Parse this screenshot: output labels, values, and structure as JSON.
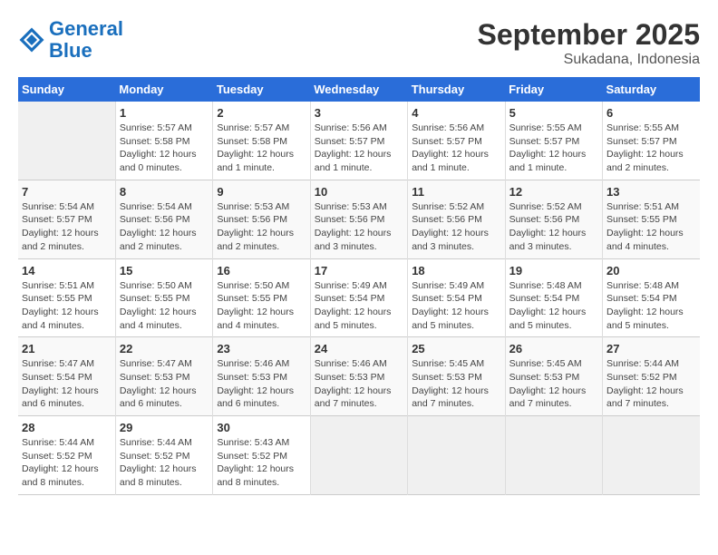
{
  "header": {
    "logo_line1": "General",
    "logo_line2": "Blue",
    "title": "September 2025",
    "subtitle": "Sukadana, Indonesia"
  },
  "calendar": {
    "days_of_week": [
      "Sunday",
      "Monday",
      "Tuesday",
      "Wednesday",
      "Thursday",
      "Friday",
      "Saturday"
    ],
    "weeks": [
      [
        {
          "day": "",
          "info": ""
        },
        {
          "day": "1",
          "info": "Sunrise: 5:57 AM\nSunset: 5:58 PM\nDaylight: 12 hours\nand 0 minutes."
        },
        {
          "day": "2",
          "info": "Sunrise: 5:57 AM\nSunset: 5:58 PM\nDaylight: 12 hours\nand 1 minute."
        },
        {
          "day": "3",
          "info": "Sunrise: 5:56 AM\nSunset: 5:57 PM\nDaylight: 12 hours\nand 1 minute."
        },
        {
          "day": "4",
          "info": "Sunrise: 5:56 AM\nSunset: 5:57 PM\nDaylight: 12 hours\nand 1 minute."
        },
        {
          "day": "5",
          "info": "Sunrise: 5:55 AM\nSunset: 5:57 PM\nDaylight: 12 hours\nand 1 minute."
        },
        {
          "day": "6",
          "info": "Sunrise: 5:55 AM\nSunset: 5:57 PM\nDaylight: 12 hours\nand 2 minutes."
        }
      ],
      [
        {
          "day": "7",
          "info": "Sunrise: 5:54 AM\nSunset: 5:57 PM\nDaylight: 12 hours\nand 2 minutes."
        },
        {
          "day": "8",
          "info": "Sunrise: 5:54 AM\nSunset: 5:56 PM\nDaylight: 12 hours\nand 2 minutes."
        },
        {
          "day": "9",
          "info": "Sunrise: 5:53 AM\nSunset: 5:56 PM\nDaylight: 12 hours\nand 2 minutes."
        },
        {
          "day": "10",
          "info": "Sunrise: 5:53 AM\nSunset: 5:56 PM\nDaylight: 12 hours\nand 3 minutes."
        },
        {
          "day": "11",
          "info": "Sunrise: 5:52 AM\nSunset: 5:56 PM\nDaylight: 12 hours\nand 3 minutes."
        },
        {
          "day": "12",
          "info": "Sunrise: 5:52 AM\nSunset: 5:56 PM\nDaylight: 12 hours\nand 3 minutes."
        },
        {
          "day": "13",
          "info": "Sunrise: 5:51 AM\nSunset: 5:55 PM\nDaylight: 12 hours\nand 4 minutes."
        }
      ],
      [
        {
          "day": "14",
          "info": "Sunrise: 5:51 AM\nSunset: 5:55 PM\nDaylight: 12 hours\nand 4 minutes."
        },
        {
          "day": "15",
          "info": "Sunrise: 5:50 AM\nSunset: 5:55 PM\nDaylight: 12 hours\nand 4 minutes."
        },
        {
          "day": "16",
          "info": "Sunrise: 5:50 AM\nSunset: 5:55 PM\nDaylight: 12 hours\nand 4 minutes."
        },
        {
          "day": "17",
          "info": "Sunrise: 5:49 AM\nSunset: 5:54 PM\nDaylight: 12 hours\nand 5 minutes."
        },
        {
          "day": "18",
          "info": "Sunrise: 5:49 AM\nSunset: 5:54 PM\nDaylight: 12 hours\nand 5 minutes."
        },
        {
          "day": "19",
          "info": "Sunrise: 5:48 AM\nSunset: 5:54 PM\nDaylight: 12 hours\nand 5 minutes."
        },
        {
          "day": "20",
          "info": "Sunrise: 5:48 AM\nSunset: 5:54 PM\nDaylight: 12 hours\nand 5 minutes."
        }
      ],
      [
        {
          "day": "21",
          "info": "Sunrise: 5:47 AM\nSunset: 5:54 PM\nDaylight: 12 hours\nand 6 minutes."
        },
        {
          "day": "22",
          "info": "Sunrise: 5:47 AM\nSunset: 5:53 PM\nDaylight: 12 hours\nand 6 minutes."
        },
        {
          "day": "23",
          "info": "Sunrise: 5:46 AM\nSunset: 5:53 PM\nDaylight: 12 hours\nand 6 minutes."
        },
        {
          "day": "24",
          "info": "Sunrise: 5:46 AM\nSunset: 5:53 PM\nDaylight: 12 hours\nand 7 minutes."
        },
        {
          "day": "25",
          "info": "Sunrise: 5:45 AM\nSunset: 5:53 PM\nDaylight: 12 hours\nand 7 minutes."
        },
        {
          "day": "26",
          "info": "Sunrise: 5:45 AM\nSunset: 5:53 PM\nDaylight: 12 hours\nand 7 minutes."
        },
        {
          "day": "27",
          "info": "Sunrise: 5:44 AM\nSunset: 5:52 PM\nDaylight: 12 hours\nand 7 minutes."
        }
      ],
      [
        {
          "day": "28",
          "info": "Sunrise: 5:44 AM\nSunset: 5:52 PM\nDaylight: 12 hours\nand 8 minutes."
        },
        {
          "day": "29",
          "info": "Sunrise: 5:44 AM\nSunset: 5:52 PM\nDaylight: 12 hours\nand 8 minutes."
        },
        {
          "day": "30",
          "info": "Sunrise: 5:43 AM\nSunset: 5:52 PM\nDaylight: 12 hours\nand 8 minutes."
        },
        {
          "day": "",
          "info": ""
        },
        {
          "day": "",
          "info": ""
        },
        {
          "day": "",
          "info": ""
        },
        {
          "day": "",
          "info": ""
        }
      ]
    ]
  }
}
